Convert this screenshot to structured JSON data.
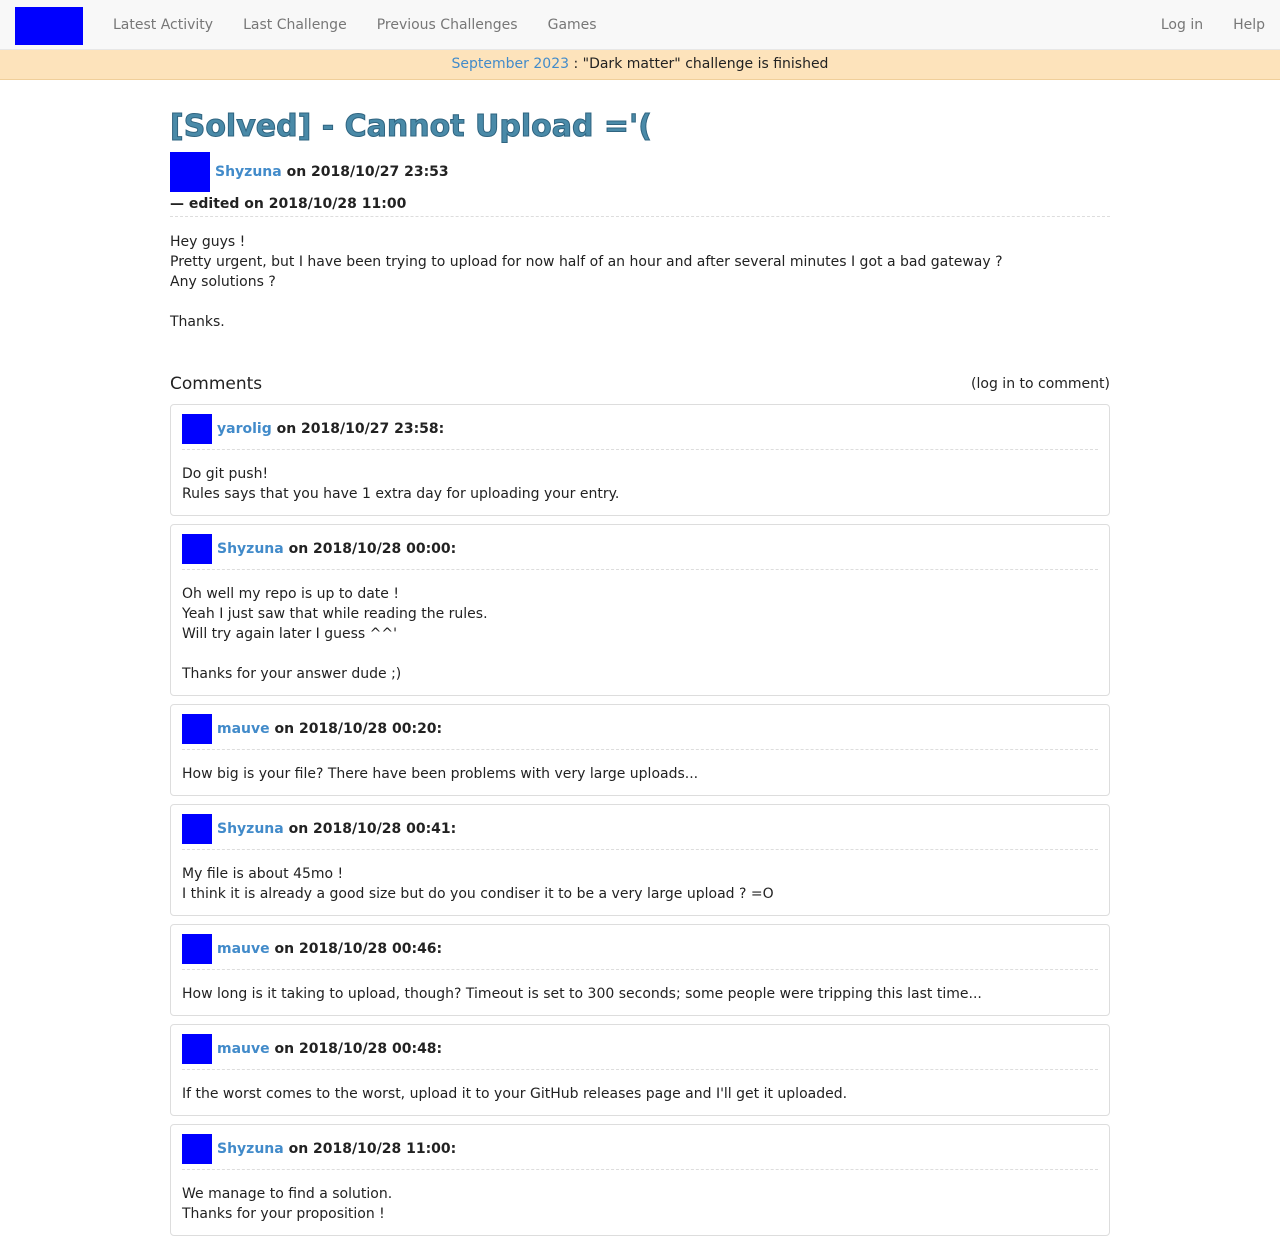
{
  "nav": {
    "items": [
      "Latest Activity",
      "Last Challenge",
      "Previous Challenges",
      "Games"
    ],
    "right": [
      "Log in",
      "Help"
    ]
  },
  "announcement": {
    "link": "September 2023",
    "text": " : \"Dark matter\" challenge is finished"
  },
  "post": {
    "title": "[Solved] - Cannot Upload ='(",
    "author": "Shyzuna",
    "date": " on 2018/10/27 23:53",
    "edited": "— edited on 2018/10/28 11:00",
    "body": [
      "Hey guys !",
      "Pretty urgent, but I have been trying to upload for now half of an hour and after several minutes I got a bad gateway ?",
      "Any solutions ?",
      "",
      "Thanks."
    ]
  },
  "comments_section": {
    "title": "Comments",
    "login_note": "(log in to comment)"
  },
  "comments": [
    {
      "author": "yarolig",
      "date": " on 2018/10/27 23:58:",
      "body": [
        "Do git push!",
        "Rules says that you have 1 extra day for uploading your entry."
      ]
    },
    {
      "author": "Shyzuna",
      "date": " on 2018/10/28 00:00:",
      "body": [
        "Oh well my repo is up to date !",
        "Yeah I just saw that while reading the rules.",
        "Will try again later I guess ^^'",
        "",
        "Thanks for your answer dude ;)"
      ]
    },
    {
      "author": "mauve",
      "date": " on 2018/10/28 00:20:",
      "body": [
        "How big is your file? There have been problems with very large uploads..."
      ]
    },
    {
      "author": "Shyzuna",
      "date": " on 2018/10/28 00:41:",
      "body": [
        "My file is about 45mo !",
        "I think it is already a good size but do you condiser it to be a very large upload ? =O"
      ]
    },
    {
      "author": "mauve",
      "date": " on 2018/10/28 00:46:",
      "body": [
        "How long is it taking to upload, though? Timeout is set to 300 seconds; some people were tripping this last time..."
      ]
    },
    {
      "author": "mauve",
      "date": " on 2018/10/28 00:48:",
      "body": [
        "If the worst comes to the worst, upload it to your GitHub releases page and I'll get it uploaded."
      ]
    },
    {
      "author": "Shyzuna",
      "date": " on 2018/10/28 11:00:",
      "body": [
        "We manage to find a solution.",
        "Thanks for your proposition !"
      ]
    }
  ]
}
